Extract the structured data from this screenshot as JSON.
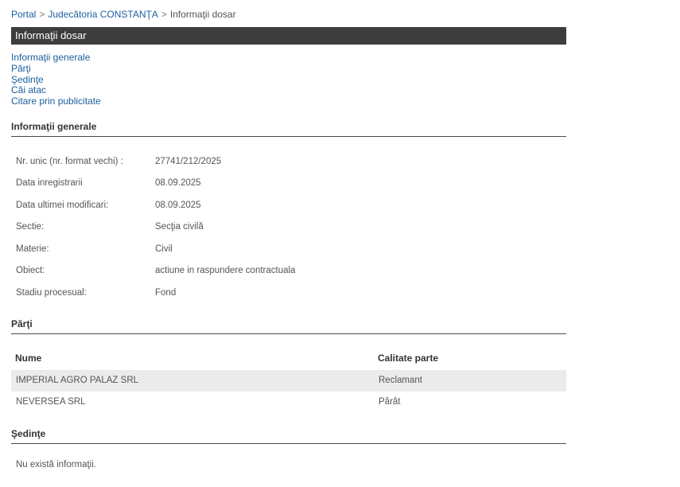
{
  "breadcrumb": {
    "home": "Portal",
    "court": "Judecătoria CONSTANŢA",
    "current": "Informaţii dosar",
    "separator": ">"
  },
  "title_bar": "Informaţii dosar",
  "anchors": [
    "Informaţii generale",
    "Părţi",
    "Şedinţe",
    "Căi atac",
    "Citare prin publicitate"
  ],
  "sections": {
    "general": "Informaţii generale",
    "parties": "Părţi",
    "hearings": "Şedinţe"
  },
  "general_info": [
    {
      "label": "Nr. unic (nr. format vechi) :",
      "value": "27741/212/2025"
    },
    {
      "label": "Data inregistrarii",
      "value": "08.09.2025"
    },
    {
      "label": "Data ultimei modificari:",
      "value": "08.09.2025"
    },
    {
      "label": "Sectie:",
      "value": "Secţia civilă"
    },
    {
      "label": "Materie:",
      "value": "Civil"
    },
    {
      "label": "Obiect:",
      "value": "actiune in raspundere contractuala"
    },
    {
      "label": "Stadiu procesual:",
      "value": "Fond"
    }
  ],
  "parties_table": {
    "headers": {
      "name": "Nume",
      "role": "Calitate parte"
    },
    "rows": [
      {
        "name": "IMPERIAL AGRO PALAZ SRL",
        "role": "Reclamant"
      },
      {
        "name": "NEVERSEA SRL",
        "role": "Pârât"
      }
    ]
  },
  "hearings": {
    "empty_text": "Nu există informaţii."
  }
}
